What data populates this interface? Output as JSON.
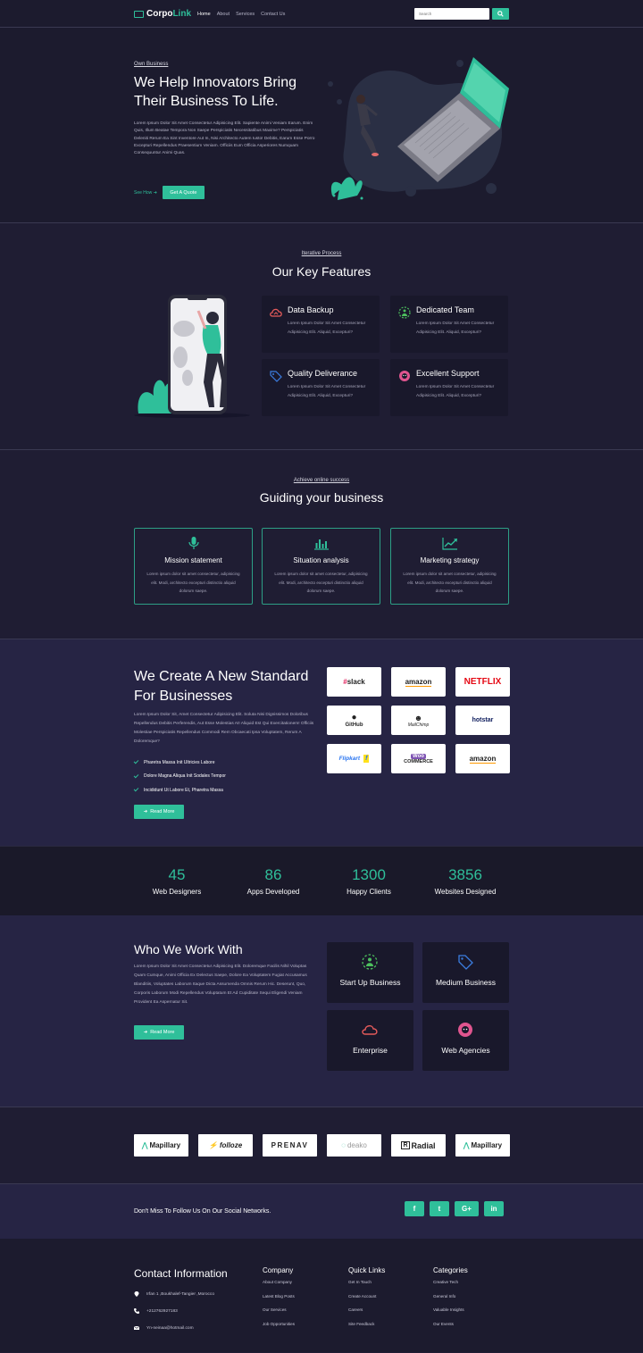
{
  "nav": {
    "logo_prefix": "Corpo",
    "logo_accent": "Link",
    "items": [
      "Home",
      "About",
      "Services",
      "Contact Us"
    ],
    "search_placeholder": "Search"
  },
  "hero": {
    "eyebrow": "Own Business",
    "title": "We Help Innovators Bring Their Business To Life.",
    "body": "Lorem Ipsum Dolor Sit Amet Consectetur Adipisicing Elit. Sapiente Animi Veniam Earum. Enim Quis, Illum Beatae Tempora Non Saepe Perspiciatis Necessitatibus Maxime? Perspiciatis Deleniti Rerum Ea Sint Inventore Aut In, Nisi Architecto Autem Iusto! Debitis, Earum Esse Porro Excepturi Repellendus Praesentium Veniam. Officiis Eum Officia Asperiores Numquam Consequuntur Animi Quas.",
    "see_how": "See How",
    "quote_button": "Get A Quote"
  },
  "features": {
    "eyebrow": "Iterative Process",
    "title": "Our Key Features",
    "cards": [
      {
        "title": "Data Backup",
        "body": "Lorem Ipsum Dolor Sit Amet Consectetur Adipisicing Elit. Aliquid, Excepturi?",
        "icon": "cloud-icon"
      },
      {
        "title": "Dedicated Team",
        "body": "Lorem Ipsum Dolor Sit Amet Consectetur Adipisicing Elit. Aliquid, Excepturi?",
        "icon": "team-icon"
      },
      {
        "title": "Quality Deliverance",
        "body": "Lorem Ipsum Dolor Sit Amet Consectetur Adipisicing Elit. Aliquid, Excepturi?",
        "icon": "tag-icon"
      },
      {
        "title": "Excellent Support",
        "body": "Lorem Ipsum Dolor Sit Amet Consectetur Adipisicing Elit. Aliquid, Excepturi?",
        "icon": "support-icon"
      }
    ]
  },
  "guiding": {
    "eyebrow": "Achieve online success",
    "title": "Guiding your business",
    "cards": [
      {
        "title": "Mission statement",
        "body": "Lorem ipsum dolor sit amet consectetur, adipisicing elit. Modi, architecto excepturi distinctio aliquid dolorum saepe.",
        "icon": "microphone-icon"
      },
      {
        "title": "Situation analysis",
        "body": "Lorem ipsum dolor sit amet consectetur, adipisicing elit. Modi, architecto excepturi distinctio aliquid dolorum saepe.",
        "icon": "bar-chart-icon"
      },
      {
        "title": "Marketing strategy",
        "body": "Lorem ipsum dolor sit amet consectetur, adipisicing elit. Modi, architecto excepturi distinctio aliquid dolorum saepe.",
        "icon": "trend-line-icon"
      }
    ]
  },
  "standard": {
    "title": "We Create A New Standard For Businesses",
    "body": "Lorem Ipsum Dolor Sit, Amet Consectetur Adipisicing Elit. Soluta Nisi Dignissimos Doloribus Repellendus Debitis Perferendis, Aut Esse Molestias At! Aliquid Est Qui Exercitationem! Officiis Molestiae Perspiciatis Repellendus Commodi Rem Obcaecati Ipsa Voluptatem, Rerum A Doloremque?",
    "checklist": [
      "Pharetra Massa Init Ultricies Labore",
      "Dolore Magna Aliqua Init Sodales Tempor",
      "Incididunt Ut Labore Et, Pharetra Massa"
    ],
    "read_more": "Read More",
    "logos": [
      "slack",
      "amazon",
      "NETFLIX",
      "GitHub",
      "MailChimp",
      "hotstar",
      "Flipkart",
      "COMMERCE",
      "amazon"
    ]
  },
  "stats": [
    {
      "value": "45",
      "label": "Web Designers"
    },
    {
      "value": "86",
      "label": "Apps Developed"
    },
    {
      "value": "1300",
      "label": "Happy Clients"
    },
    {
      "value": "3856",
      "label": "Websites Designed"
    }
  ],
  "who": {
    "title": "Who We Work With",
    "body": "Lorem Ipsum Dolor Sit Amet Consectetur Adipisicing Elit. Doloremque Facilis Nihil Voluptas Quam Cumque, Animi Officia Ex Delectus Saepe, Dolore Ea Voluptatem Fugiat Accusamus Blanditiis, Voluptates Laborum Itaque Dicta Assumenda Omnis Rerum Hic. Deserunt, Quo, Corporis Laborum Modi Repellendus Voluptatum Et Ad Cupiditate Sequi Eligendi Veniam Provident Ea Aspernatur Sit.",
    "read_more": "Read More",
    "cards": [
      {
        "title": "Start Up Business",
        "icon": "team-icon"
      },
      {
        "title": "Medium Business",
        "icon": "tag-icon"
      },
      {
        "title": "Enterprise",
        "icon": "cloud-icon"
      },
      {
        "title": "Web Agencies",
        "icon": "support-icon"
      }
    ]
  },
  "clients": [
    "Mapillary",
    "folloze",
    "PRENAV",
    "deako",
    "Radial",
    "Mapillary"
  ],
  "social": {
    "text": "Don't Miss To Follow Us On Our Social Networks.",
    "buttons": [
      "f",
      "t",
      "G+",
      "in"
    ]
  },
  "footer": {
    "contact_title": "Contact Information",
    "address": "Irfan 1 ,Boukhalef-Tangier ,Morocco",
    "phone": "+212762927183",
    "email": "Yn-neinaa@hotmail.com",
    "columns": [
      {
        "title": "Company",
        "links": [
          "About Company",
          "Latest Blog Posts",
          "Our Services",
          "Job Opportunities"
        ]
      },
      {
        "title": "Quick Links",
        "links": [
          "Get In Touch",
          "Create Account",
          "Careers",
          "Site Feedback"
        ]
      },
      {
        "title": "Categories",
        "links": [
          "Creative Tech",
          "General Info",
          "Valuable Insights",
          "Our Events"
        ]
      }
    ]
  },
  "colors": {
    "accent": "#2fbf9a",
    "background": "#1f1d33",
    "card": "#19182b"
  }
}
